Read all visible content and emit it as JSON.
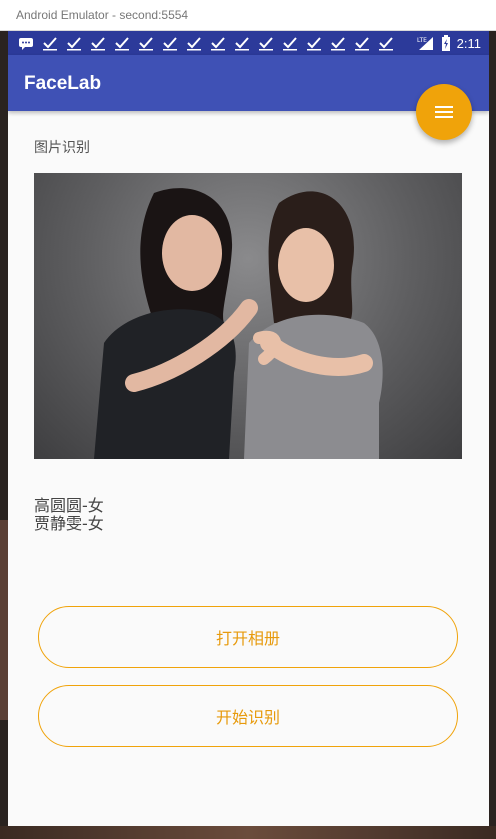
{
  "window": {
    "title": "Android Emulator - second:5554"
  },
  "statusbar": {
    "network": "LTE",
    "time": "2:11",
    "notification_icons": [
      "message-icon",
      "check-icon",
      "check-icon",
      "check-icon",
      "check-icon",
      "check-icon",
      "check-icon",
      "check-icon",
      "check-icon",
      "check-icon",
      "check-icon",
      "check-icon",
      "check-icon",
      "check-icon",
      "check-icon",
      "check-icon"
    ]
  },
  "appbar": {
    "title": "FaceLab"
  },
  "fab": {
    "icon": "menu-icon",
    "color": "#f0a30a"
  },
  "main": {
    "section_label": "图片识别",
    "photo_description": "photo of two women posing",
    "results": [
      "高圆圆-女",
      "贾静雯-女"
    ],
    "open_album_label": "打开相册",
    "start_recognition_label": "开始识别"
  },
  "colors": {
    "primary": "#3f51b5",
    "primary_dark": "#2c3a9a",
    "accent": "#f0a30a"
  }
}
